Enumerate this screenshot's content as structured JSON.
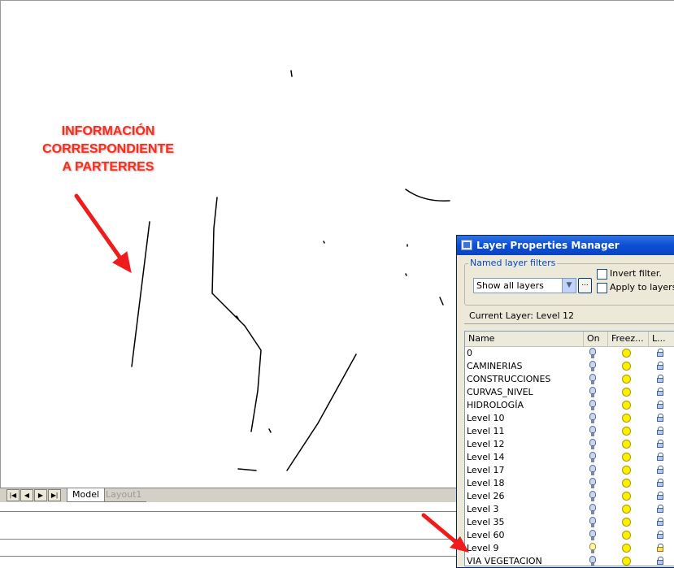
{
  "annotation": {
    "lines": [
      "INFORMACIÓN",
      "CORRESPONDIENTE",
      "A PARTERRES"
    ],
    "color": "#ff2a1a"
  },
  "tabs": {
    "nav_icons": [
      "first-tab-icon",
      "prev-tab-icon",
      "next-tab-icon",
      "last-tab-icon"
    ],
    "model": "Model",
    "layout": "Layout1"
  },
  "dialog": {
    "title": "Layer Properties Manager",
    "named_filters_label": "Named layer filters",
    "filter_value": "Show all layers",
    "filter_more": "...",
    "invert_filter_label": "Invert filter.",
    "apply_to_layers_label": "Apply to layers t",
    "current_layer_label": "Current Layer:  Level 12",
    "columns": {
      "name": "Name",
      "on": "On",
      "freeze": "Freez...",
      "lock": "L..."
    },
    "layers": [
      {
        "name": "0",
        "on": true,
        "frozen": false,
        "locked": false
      },
      {
        "name": "CAMINERIAS",
        "on": true,
        "frozen": false,
        "locked": false
      },
      {
        "name": "CONSTRUCCIONES",
        "on": true,
        "frozen": false,
        "locked": false
      },
      {
        "name": "CURVAS_NIVEL",
        "on": true,
        "frozen": false,
        "locked": false
      },
      {
        "name": "HIDROLOGÍA",
        "on": true,
        "frozen": false,
        "locked": false
      },
      {
        "name": "Level 10",
        "on": true,
        "frozen": false,
        "locked": false
      },
      {
        "name": "Level 11",
        "on": true,
        "frozen": false,
        "locked": false
      },
      {
        "name": "Level 12",
        "on": true,
        "frozen": false,
        "locked": false
      },
      {
        "name": "Level 14",
        "on": true,
        "frozen": false,
        "locked": false
      },
      {
        "name": "Level 17",
        "on": true,
        "frozen": false,
        "locked": false
      },
      {
        "name": "Level 18",
        "on": true,
        "frozen": false,
        "locked": false
      },
      {
        "name": "Level 26",
        "on": true,
        "frozen": false,
        "locked": false
      },
      {
        "name": "Level 3",
        "on": true,
        "frozen": false,
        "locked": false
      },
      {
        "name": "Level 35",
        "on": true,
        "frozen": false,
        "locked": false
      },
      {
        "name": "Level 60",
        "on": true,
        "frozen": false,
        "locked": false
      },
      {
        "name": "Level 9",
        "on": true,
        "frozen": false,
        "locked": true
      },
      {
        "name": "VIA VEGETACION",
        "on": true,
        "frozen": false,
        "locked": false
      }
    ]
  },
  "colors": {
    "arrow": "#ee1c1c",
    "titlebar": "#0b4fd5"
  }
}
